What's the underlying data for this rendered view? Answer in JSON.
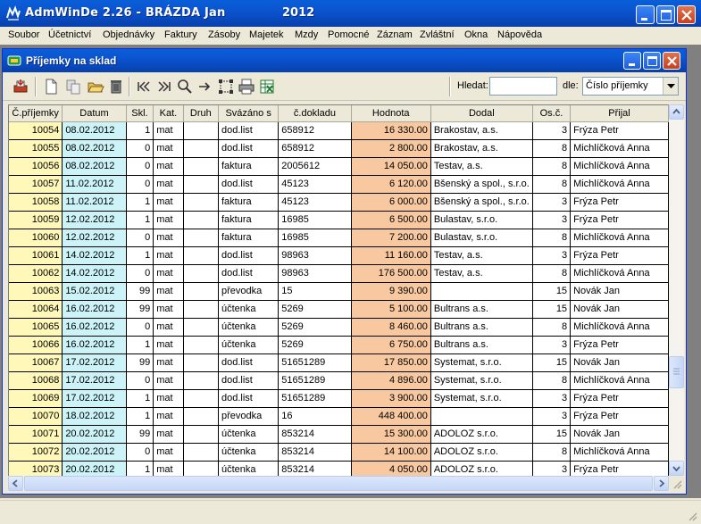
{
  "app": {
    "title": "AdmWinDe 2.26 - BRÁZDA Jan",
    "year": "2012"
  },
  "menu": [
    "Soubor",
    "Účetnictví",
    "Objednávky",
    "Faktury",
    "Zásoby",
    "Majetek",
    "Mzdy",
    "Pomocné",
    "Záznam",
    "Zvláštní",
    "Okna",
    "Nápověda"
  ],
  "window": {
    "title": "Příjemky na sklad"
  },
  "toolbar": {
    "search_label": "Hledat:",
    "search_value": "",
    "by_label": "dle:",
    "sort_by": "Číslo příjemky",
    "icons": [
      "print-icon",
      "new-document-icon",
      "copy-document-icon",
      "open-folder-icon",
      "delete-icon",
      "first-record-icon",
      "last-record-icon",
      "search-icon",
      "goto-icon",
      "select-range-icon",
      "printer-icon",
      "excel-export-icon"
    ]
  },
  "columns": [
    "Č.příjemky",
    "Datum",
    "Skl.",
    "Kat.",
    "Druh",
    "Svázáno s",
    "č.dokladu",
    "Hodnota",
    "Dodal",
    "Os.č.",
    "Přijal"
  ],
  "rows": [
    [
      "10054",
      "08.02.2012",
      "1",
      "mat",
      "",
      "dod.list",
      "658912",
      "16 330.00",
      "Brakostav, a.s.",
      "3",
      "Frýza Petr"
    ],
    [
      "10055",
      "08.02.2012",
      "0",
      "mat",
      "",
      "dod.list",
      "658912",
      "2 800.00",
      "Brakostav, a.s.",
      "8",
      "Michlíčková Anna"
    ],
    [
      "10056",
      "08.02.2012",
      "0",
      "mat",
      "",
      "faktura",
      "2005612",
      "14 050.00",
      "Testav, a.s.",
      "8",
      "Michlíčková Anna"
    ],
    [
      "10057",
      "11.02.2012",
      "0",
      "mat",
      "",
      "dod.list",
      "45123",
      "6 120.00",
      "Bšenský a spol., s.r.o.",
      "8",
      "Michlíčková Anna"
    ],
    [
      "10058",
      "11.02.2012",
      "1",
      "mat",
      "",
      "faktura",
      "45123",
      "6 000.00",
      "Bšenský a spol., s.r.o.",
      "3",
      "Frýza Petr"
    ],
    [
      "10059",
      "12.02.2012",
      "1",
      "mat",
      "",
      "faktura",
      "16985",
      "6 500.00",
      "Bulastav, s.r.o.",
      "3",
      "Frýza Petr"
    ],
    [
      "10060",
      "12.02.2012",
      "0",
      "mat",
      "",
      "faktura",
      "16985",
      "7 200.00",
      "Bulastav, s.r.o.",
      "8",
      "Michlíčková Anna"
    ],
    [
      "10061",
      "14.02.2012",
      "1",
      "mat",
      "",
      "dod.list",
      "98963",
      "11 160.00",
      "Testav, a.s.",
      "3",
      "Frýza Petr"
    ],
    [
      "10062",
      "14.02.2012",
      "0",
      "mat",
      "",
      "dod.list",
      "98963",
      "176 500.00",
      "Testav, a.s.",
      "8",
      "Michlíčková Anna"
    ],
    [
      "10063",
      "15.02.2012",
      "99",
      "mat",
      "",
      "převodka",
      "15",
      "9 390.00",
      "",
      "15",
      "Novák Jan"
    ],
    [
      "10064",
      "16.02.2012",
      "99",
      "mat",
      "",
      "účtenka",
      "5269",
      "5 100.00",
      "Bultrans a.s.",
      "15",
      "Novák Jan"
    ],
    [
      "10065",
      "16.02.2012",
      "0",
      "mat",
      "",
      "účtenka",
      "5269",
      "8 460.00",
      "Bultrans a.s.",
      "8",
      "Michlíčková Anna"
    ],
    [
      "10066",
      "16.02.2012",
      "1",
      "mat",
      "",
      "účtenka",
      "5269",
      "6 750.00",
      "Bultrans a.s.",
      "3",
      "Frýza Petr"
    ],
    [
      "10067",
      "17.02.2012",
      "99",
      "mat",
      "",
      "dod.list",
      "51651289",
      "17 850.00",
      "Systemat, s.r.o.",
      "15",
      "Novák Jan"
    ],
    [
      "10068",
      "17.02.2012",
      "0",
      "mat",
      "",
      "dod.list",
      "51651289",
      "4 896.00",
      "Systemat, s.r.o.",
      "8",
      "Michlíčková Anna"
    ],
    [
      "10069",
      "17.02.2012",
      "1",
      "mat",
      "",
      "dod.list",
      "51651289",
      "3 900.00",
      "Systemat, s.r.o.",
      "3",
      "Frýza Petr"
    ],
    [
      "10070",
      "18.02.2012",
      "1",
      "mat",
      "",
      "převodka",
      "16",
      "448 400.00",
      "",
      "3",
      "Frýza Petr"
    ],
    [
      "10071",
      "20.02.2012",
      "99",
      "mat",
      "",
      "účtenka",
      "853214",
      "15 300.00",
      "ADOLOZ s.r.o.",
      "15",
      "Novák Jan"
    ],
    [
      "10072",
      "20.02.2012",
      "0",
      "mat",
      "",
      "účtenka",
      "853214",
      "14 100.00",
      "ADOLOZ s.r.o.",
      "8",
      "Michlíčková Anna"
    ],
    [
      "10073",
      "20.02.2012",
      "1",
      "mat",
      "",
      "účtenka",
      "853214",
      "4 050.00",
      "ADOLOZ s.r.o.",
      "3",
      "Frýza Petr"
    ]
  ],
  "colors": {
    "number_column": "#fff8b8",
    "date_column": "#ccf4f8",
    "value_column": "#f8c8a0",
    "titlebar": "#0b54d0"
  }
}
